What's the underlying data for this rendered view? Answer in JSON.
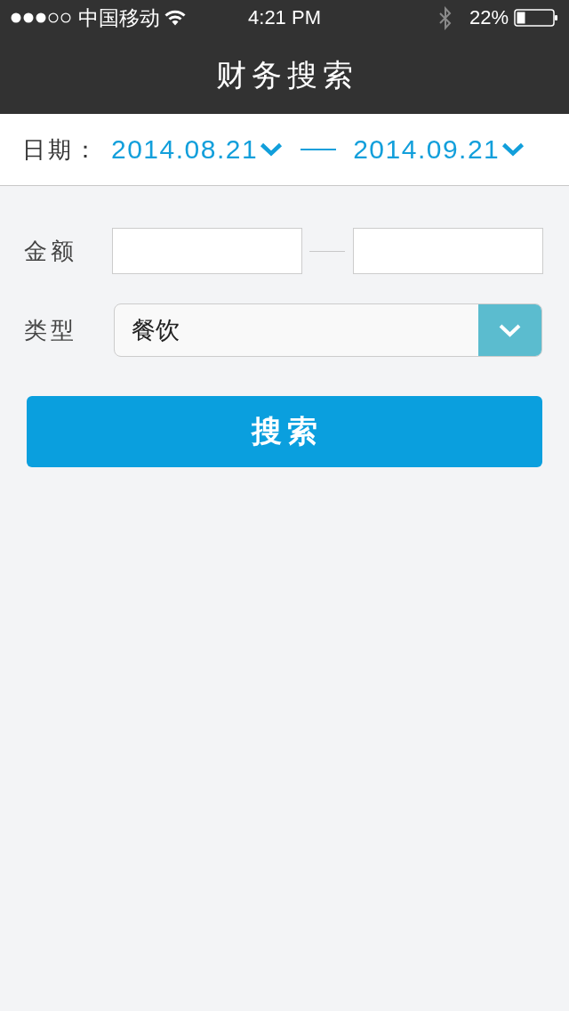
{
  "status_bar": {
    "carrier": "中国移动",
    "time": "4:21 PM",
    "battery": "22%"
  },
  "nav_bar": {
    "title": "财务搜索"
  },
  "date_filter": {
    "label": "日期：",
    "start_date": "2014.08.21",
    "end_date": "2014.09.21"
  },
  "amount_filter": {
    "label": "金额"
  },
  "type_filter": {
    "label": "类型",
    "value": "餐饮"
  },
  "search_button": {
    "label": "搜索"
  }
}
